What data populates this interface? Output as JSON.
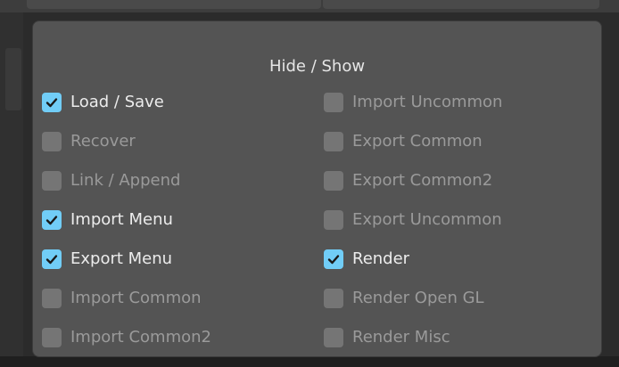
{
  "popup": {
    "title": "Hide / Show",
    "left_options": [
      {
        "label": "Load / Save",
        "checked": true
      },
      {
        "label": "Recover",
        "checked": false
      },
      {
        "label": "Link / Append",
        "checked": false
      },
      {
        "label": "Import Menu",
        "checked": true
      },
      {
        "label": "Export Menu",
        "checked": true
      },
      {
        "label": "Import Common",
        "checked": false
      },
      {
        "label": "Import Common2",
        "checked": false
      }
    ],
    "right_options": [
      {
        "label": "Import Uncommon",
        "checked": false
      },
      {
        "label": "Export Common",
        "checked": false
      },
      {
        "label": "Export Common2",
        "checked": false
      },
      {
        "label": "Export Uncommon",
        "checked": false
      },
      {
        "label": "Render",
        "checked": true
      },
      {
        "label": "Render Open GL",
        "checked": false
      },
      {
        "label": "Render Misc",
        "checked": false
      }
    ]
  },
  "colors": {
    "panel_bg": "#545454",
    "checkbox_checked": "#71cdf7",
    "checkbox_unchecked": "#757575",
    "text_checked": "#ececec",
    "text_unchecked": "#9a9a9a"
  },
  "icons": {
    "checkmark": "checkmark-icon"
  }
}
